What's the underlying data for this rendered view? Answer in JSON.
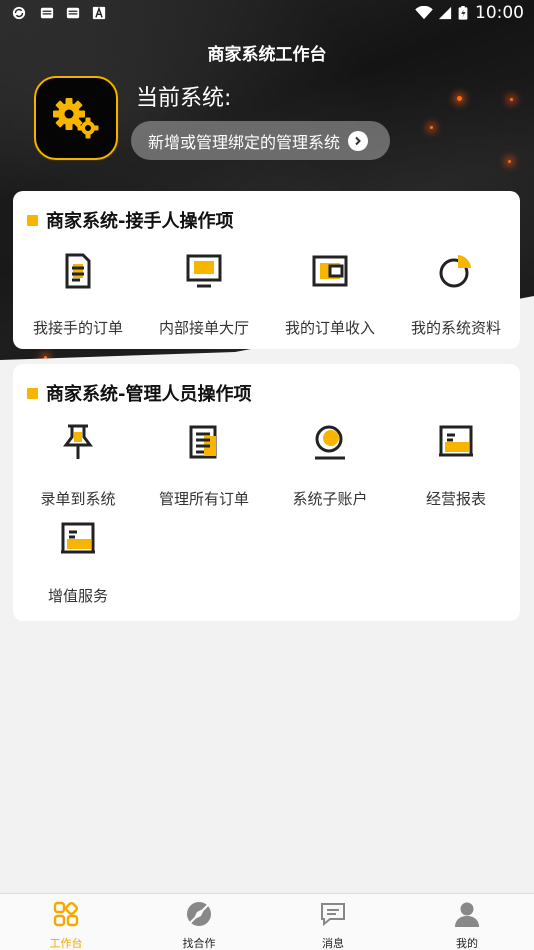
{
  "status_bar": {
    "time": "10:00"
  },
  "header": {
    "title": "商家系统工作台"
  },
  "current_system": {
    "label": "当前系统:",
    "bind_prompt": "新增或管理绑定的管理系统"
  },
  "receiver_section": {
    "title": "商家系统-接手人操作项",
    "items": [
      {
        "label": "我接手的订单",
        "icon": "document-icon"
      },
      {
        "label": "内部接单大厅",
        "icon": "monitor-icon"
      },
      {
        "label": "我的订单收入",
        "icon": "wallet-icon"
      },
      {
        "label": "我的系统资料",
        "icon": "pie-chart-icon"
      }
    ]
  },
  "manager_section": {
    "title": "商家系统-管理人员操作项",
    "items": [
      {
        "label": "录单到系统",
        "icon": "pin-icon"
      },
      {
        "label": "管理所有订单",
        "icon": "list-document-icon"
      },
      {
        "label": "系统子账户",
        "icon": "sub-account-icon"
      },
      {
        "label": "经营报表",
        "icon": "report-icon"
      },
      {
        "label": "增值服务",
        "icon": "service-icon"
      }
    ]
  },
  "tabbar": {
    "items": [
      {
        "label": "工作台",
        "icon": "grid-icon",
        "active": true
      },
      {
        "label": "找合作",
        "icon": "compass-icon",
        "active": false
      },
      {
        "label": "消息",
        "icon": "message-icon",
        "active": false
      },
      {
        "label": "我的",
        "icon": "user-icon",
        "active": false
      }
    ]
  },
  "colors": {
    "accent": "#f7b500",
    "hero": "#1a1a1a"
  }
}
